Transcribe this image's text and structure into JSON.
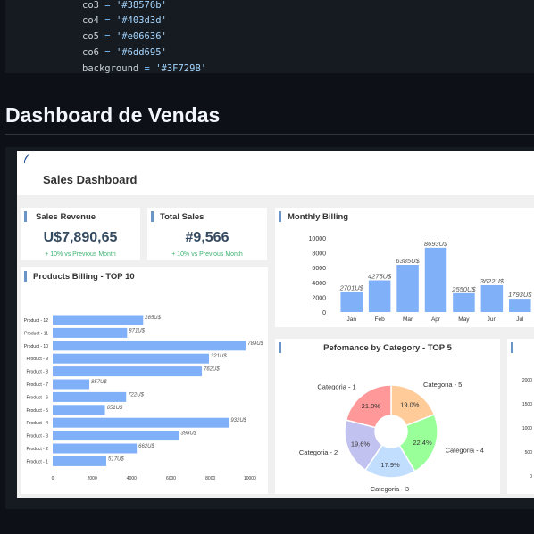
{
  "code": {
    "lines": [
      {
        "var": "co3",
        "op": "=",
        "val": "'#38576b'"
      },
      {
        "var": "co4",
        "op": "=",
        "val": "'#403d3d'"
      },
      {
        "var": "co5",
        "op": "=",
        "val": "'#e06636'"
      },
      {
        "var": "co6",
        "op": "=",
        "val": "'#6dd695'"
      },
      {
        "var": "background",
        "op": "=",
        "val": "'#3F729B'"
      }
    ]
  },
  "page": {
    "heading": "Dashboard de Vendas"
  },
  "dashboard": {
    "title": "Sales Dashboard",
    "cards": {
      "sales_revenue": {
        "title": "Sales Revenue",
        "value": "U$7,890,65",
        "sub": "+ 10% vs Previous Month"
      },
      "total_sales": {
        "title": "Total Sales",
        "value": "#9,566",
        "sub": "+ 10% vs Previous Month"
      },
      "monthly_billing": {
        "title": "Monthly Billing"
      },
      "products_billing": {
        "title": "Products Billing - TOP 10"
      },
      "category": {
        "title": "Pefomance by Category - TOP 5"
      }
    },
    "icons": {
      "plume": "plume-icon"
    },
    "colors": {
      "bar": "#7fb0f8",
      "accent": "#6b95c7",
      "positive": "#3cb371"
    }
  },
  "chart_data": [
    {
      "type": "bar",
      "title": "Monthly Billing",
      "categories": [
        "Jan",
        "Feb",
        "Mar",
        "Apr",
        "May",
        "Jun",
        "Jul"
      ],
      "values": [
        2701,
        4275,
        6385,
        8693,
        2550,
        3622,
        1793
      ],
      "data_labels": [
        "2701U$",
        "4275U$",
        "6385U$",
        "8693U$",
        "2550U$",
        "3622U$",
        "1793U$"
      ],
      "ylim": [
        0,
        10000
      ],
      "yticks": [
        "0",
        "2000",
        "4000",
        "6000",
        "8000",
        "10000"
      ],
      "color": "#7fb0f8"
    },
    {
      "type": "bar",
      "orientation": "horizontal",
      "title": "Products Billing - TOP 10",
      "categories": [
        "Product - 12",
        "Product - 11",
        "Product - 10",
        "Product - 9",
        "Product - 8",
        "Product - 7",
        "Product - 6",
        "Product - 5",
        "Product - 4",
        "Product - 3",
        "Product - 2",
        "Product - 1"
      ],
      "values": [
        4585,
        3771,
        9789,
        7921,
        7562,
        1857,
        3722,
        2651,
        8932,
        6398,
        4262,
        2717
      ],
      "data_labels": [
        "285U$",
        "871U$",
        "789U$",
        "321U$",
        "762U$",
        "857U$",
        "722U$",
        "651U$",
        "932U$",
        "398U$",
        "662U$",
        "517U$"
      ],
      "xlim": [
        0,
        11000
      ],
      "xticks": [
        "0",
        "2000",
        "4000",
        "6000",
        "8000",
        "10000"
      ],
      "color": "#7fb0f8"
    },
    {
      "type": "pie",
      "title": "Pefomance by Category - TOP 5",
      "labels": [
        "Categoria - 5",
        "Categoria - 4",
        "Categoria - 3",
        "Categoria - 2",
        "Categoria - 1"
      ],
      "values": [
        19.0,
        22.4,
        17.9,
        19.6,
        21.0
      ],
      "value_labels": [
        "19.0%",
        "22.4%",
        "17.9%",
        "19.6%",
        "21.0%"
      ],
      "colors": [
        "#ffcc99",
        "#99ff99",
        "#c2deff",
        "#c2c2f0",
        "#ff9999"
      ],
      "donut": true
    }
  ],
  "partial_chart": {
    "yticks": [
      "2000",
      "1500",
      "1000",
      "500",
      "0"
    ]
  }
}
